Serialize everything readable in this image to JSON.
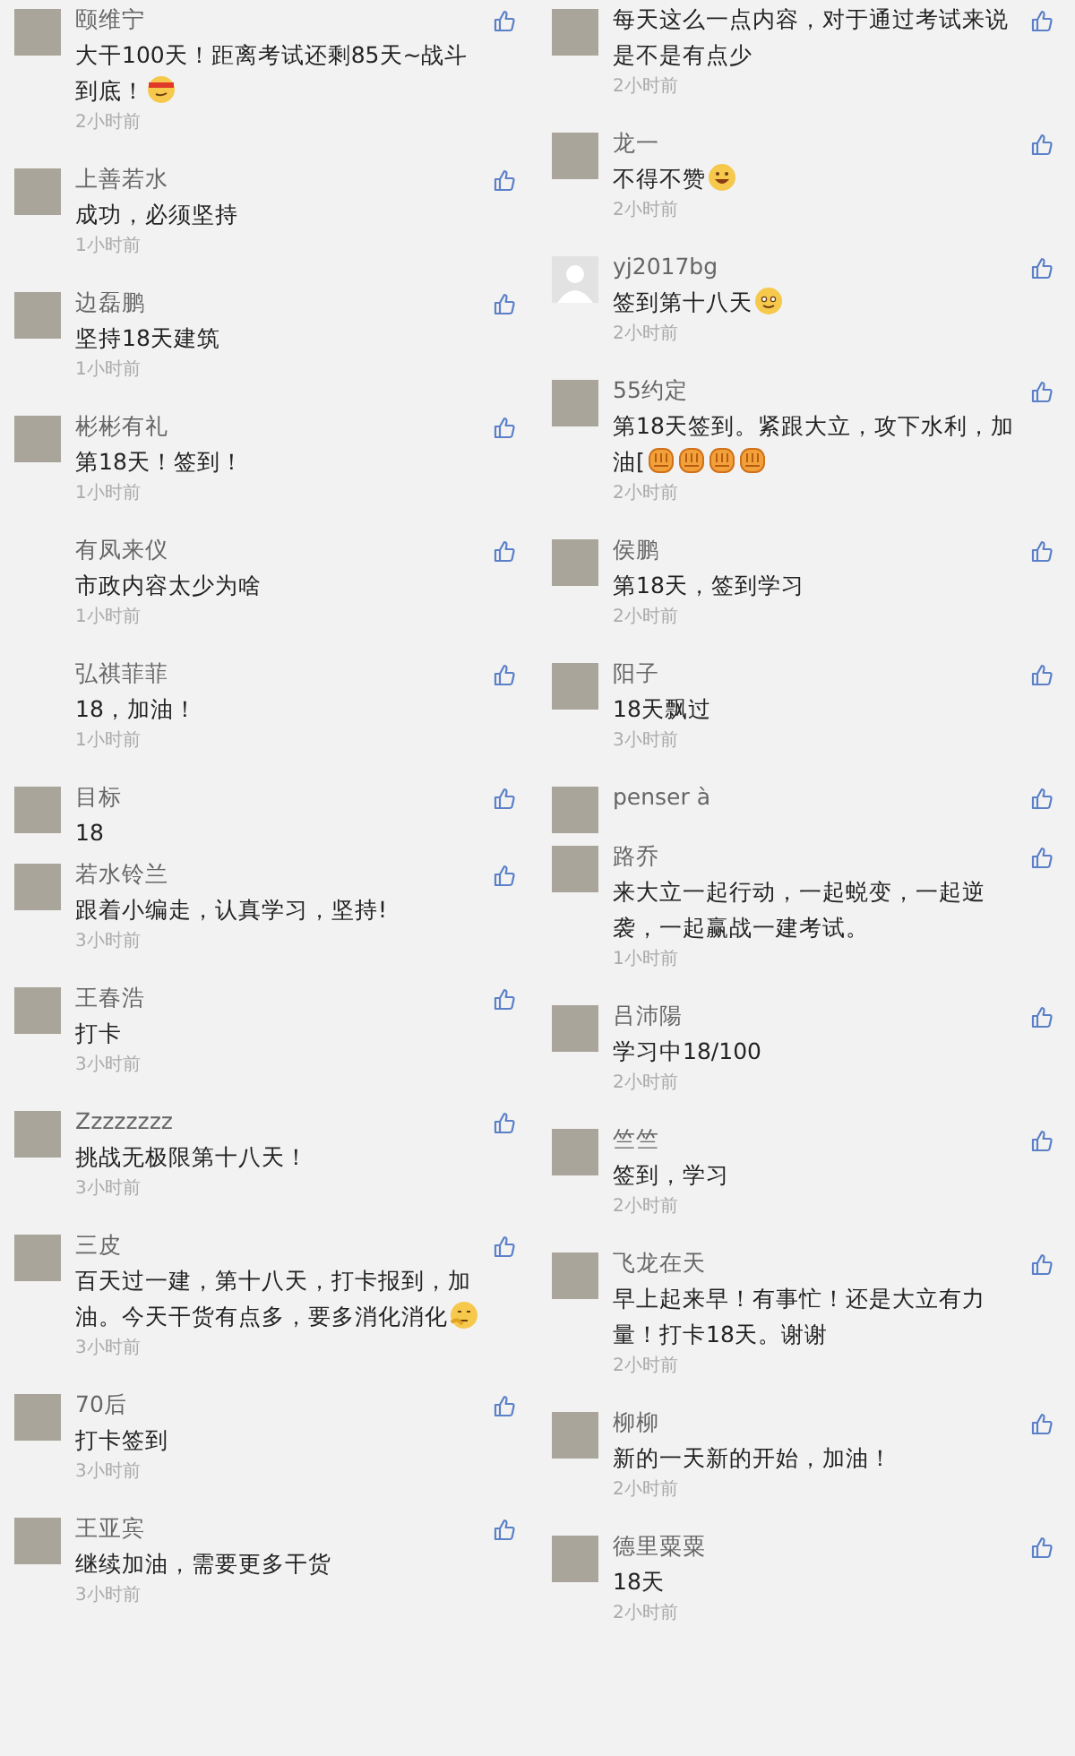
{
  "columns": [
    {
      "comments": [
        {
          "avatar": {
            "kind": "photo"
          },
          "name": "颐维宁",
          "text": "大干100天！距离考试还剩85天~战斗到底！",
          "emojis": [
            {
              "kind": "ninja"
            }
          ],
          "time": "2小时前"
        },
        {
          "avatar": {
            "kind": "photo"
          },
          "name": "上善若水",
          "text": "成功，必须坚持",
          "time": "1小时前"
        },
        {
          "avatar": {
            "kind": "photo"
          },
          "name": "边磊鹏",
          "text": "坚持18天建筑",
          "time": "1小时前"
        },
        {
          "avatar": {
            "kind": "photo"
          },
          "name": "彬彬有礼",
          "text": "第18天！签到！",
          "time": "1小时前"
        },
        {
          "name": "有凤来仪",
          "text": "市政内容太少为啥",
          "time": "1小时前"
        },
        {
          "name": "弘祺菲菲",
          "text": "18，加油！",
          "time": "1小时前"
        },
        {
          "avatar": {
            "kind": "photo"
          },
          "name": "目标",
          "text": "18"
        },
        {
          "avatar": {
            "kind": "photo"
          },
          "name": "若水铃兰",
          "text": "跟着小编走，认真学习，坚持!",
          "time": "3小时前"
        },
        {
          "avatar": {
            "kind": "photo"
          },
          "name": "王春浩",
          "text": "打卡",
          "time": "3小时前"
        },
        {
          "avatar": {
            "kind": "photo"
          },
          "name": "Zzzzzzzz",
          "text": "挑战无极限第十八天！",
          "time": "3小时前"
        },
        {
          "avatar": {
            "kind": "photo"
          },
          "name": "三皮",
          "text": "百天过一建，第十八天，打卡报到，加油。今天干货有点多，要多消化消化",
          "emojis": [
            {
              "kind": "think"
            }
          ],
          "time": "3小时前"
        },
        {
          "avatar": {
            "kind": "photo"
          },
          "name": "70后",
          "text": "打卡签到",
          "time": "3小时前"
        },
        {
          "avatar": {
            "kind": "photo"
          },
          "name": "王亚宾",
          "text": "继续加油，需要更多干货",
          "time": "3小时前"
        }
      ]
    },
    {
      "comments": [
        {
          "avatar": {
            "kind": "photo"
          },
          "text": "每天这么一点内容，对于通过考试来说是不是有点少",
          "time": "2小时前"
        },
        {
          "avatar": {
            "kind": "photo"
          },
          "name": "龙一",
          "text": "不得不赞",
          "emojis": [
            {
              "kind": "grin"
            }
          ],
          "time": "2小时前"
        },
        {
          "avatar": {
            "kind": "default"
          },
          "name": "yj2017bg",
          "text": "签到第十八天",
          "emojis": [
            {
              "kind": "smile"
            }
          ],
          "time": "2小时前"
        },
        {
          "avatar": {
            "kind": "photo"
          },
          "name": "55约定",
          "text": "第18天签到。紧跟大立，攻下水利，加油[",
          "emojis": [
            {
              "kind": "fist"
            },
            {
              "kind": "fist"
            },
            {
              "kind": "fist"
            },
            {
              "kind": "fist"
            }
          ],
          "time": "2小时前"
        },
        {
          "avatar": {
            "kind": "photo"
          },
          "name": "侯鹏",
          "text": "第18天，签到学习",
          "time": "2小时前"
        },
        {
          "avatar": {
            "kind": "photo"
          },
          "name": "阳子",
          "text": "18天飘过",
          "time": "3小时前"
        },
        {
          "avatar": {
            "kind": "photo"
          },
          "name": "penser à"
        },
        {
          "avatar": {
            "kind": "photo"
          },
          "name": "路乔",
          "text": "来大立一起行动，一起蜕变，一起逆袭，一起赢战一建考试。",
          "time": "1小时前"
        },
        {
          "avatar": {
            "kind": "photo"
          },
          "name": "吕沛陽",
          "text": "学习中18/100",
          "time": "2小时前"
        },
        {
          "avatar": {
            "kind": "photo"
          },
          "name": "竺竺",
          "text": "签到，学习",
          "time": "2小时前"
        },
        {
          "avatar": {
            "kind": "photo"
          },
          "name": "飞龙在天",
          "text": "早上起来早！有事忙！还是大立有力量！打卡18天。谢谢",
          "time": "2小时前"
        },
        {
          "avatar": {
            "kind": "photo"
          },
          "name": "柳柳",
          "text": "新的一天新的开始，加油！",
          "time": "2小时前"
        },
        {
          "avatar": {
            "kind": "photo"
          },
          "name": "德里粟粟",
          "text": "18天",
          "time": "2小时前"
        }
      ]
    }
  ]
}
